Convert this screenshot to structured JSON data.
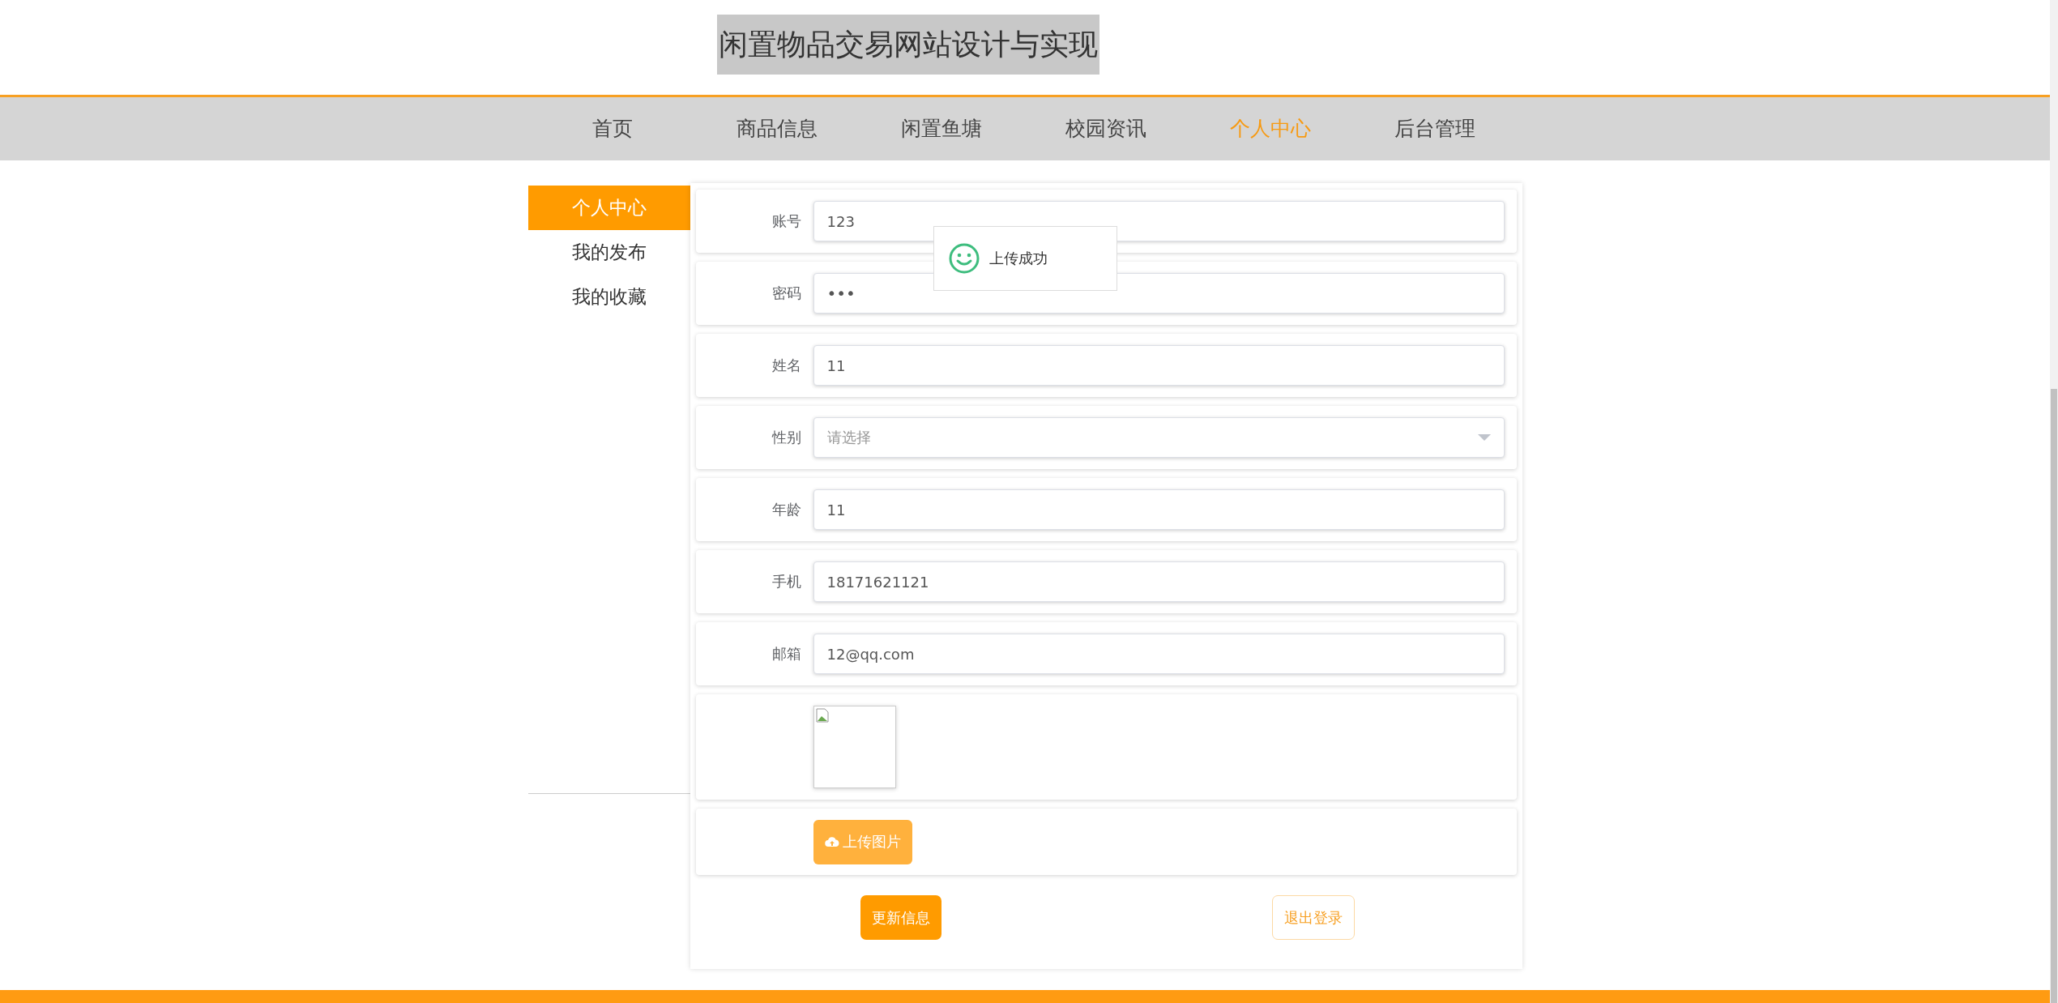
{
  "site_title": "闲置物品交易网站设计与实现",
  "nav": [
    {
      "label": "首页",
      "selected": false
    },
    {
      "label": "商品信息",
      "selected": false
    },
    {
      "label": "闲置鱼塘",
      "selected": false
    },
    {
      "label": "校园资讯",
      "selected": false
    },
    {
      "label": "个人中心",
      "selected": true
    },
    {
      "label": "后台管理",
      "selected": false
    }
  ],
  "sidebar": [
    {
      "label": "个人中心",
      "selected": true
    },
    {
      "label": "我的发布",
      "selected": false
    },
    {
      "label": "我的收藏",
      "selected": false
    }
  ],
  "form": [
    {
      "kind": "text",
      "label": "账号",
      "value": "123"
    },
    {
      "kind": "password",
      "label": "密码",
      "value": "•••"
    },
    {
      "kind": "text",
      "label": "姓名",
      "value": "11"
    },
    {
      "kind": "select",
      "label": "性别",
      "placeholder": "请选择"
    },
    {
      "kind": "text",
      "label": "年龄",
      "value": "11"
    },
    {
      "kind": "text",
      "label": "手机",
      "value": "18171621121"
    },
    {
      "kind": "text",
      "label": "邮箱",
      "value": "12@qq.com"
    }
  ],
  "upload_button": "上传图片",
  "actions": {
    "update": "更新信息",
    "logout": "退出登录"
  },
  "toast": {
    "message": "上传成功"
  }
}
